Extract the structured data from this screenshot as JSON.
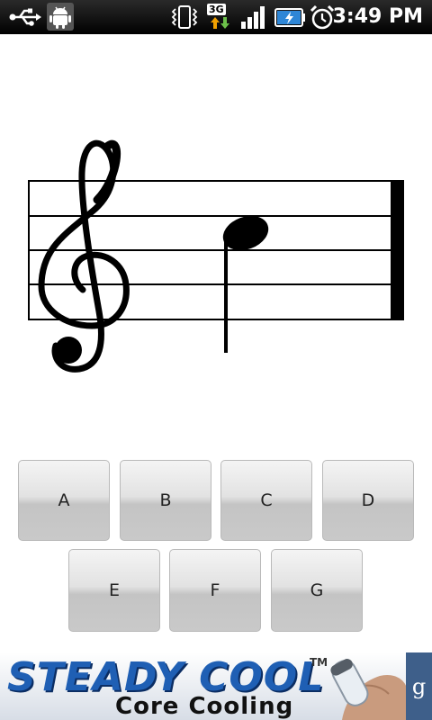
{
  "status_bar": {
    "time": "3:49 PM",
    "network_label": "3G",
    "icons": [
      "usb-icon",
      "android-debug-icon",
      "vibrate-icon",
      "data-3g-icon",
      "signal-icon",
      "battery-charging-icon",
      "alarm-icon"
    ]
  },
  "quiz": {
    "clef": "treble-clef",
    "answers_row1": [
      "A",
      "B",
      "C",
      "D"
    ],
    "answers_row2": [
      "E",
      "F",
      "G"
    ]
  },
  "ad": {
    "title": "STEADY COOL",
    "trademark": "TM",
    "subtitle": "Core Cooling",
    "network_icon": "g",
    "colors": {
      "title": "#1f5fb4",
      "network_bg": "#3e5f8a"
    }
  }
}
